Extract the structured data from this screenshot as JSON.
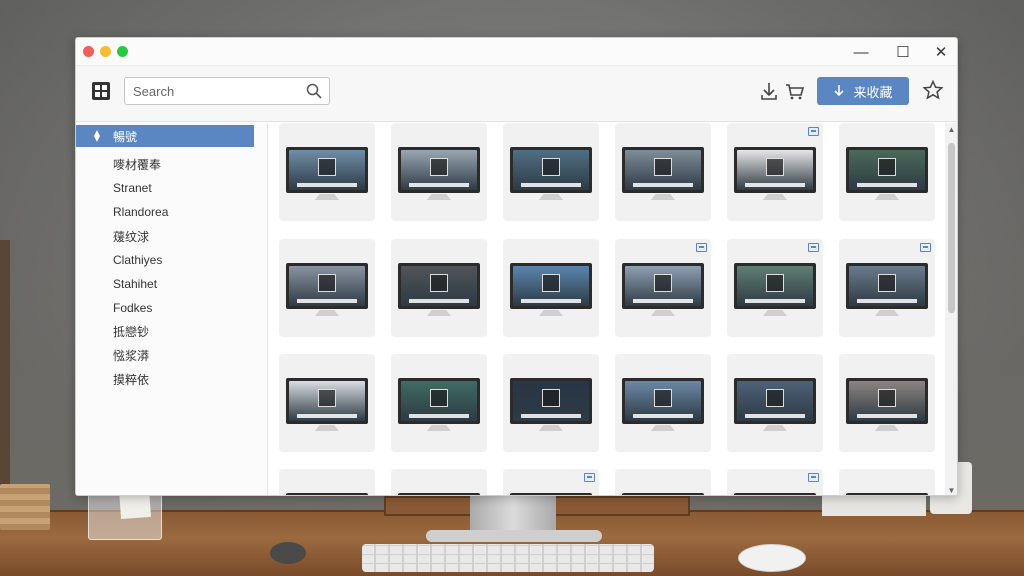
{
  "window": {
    "controls": {
      "minimize": "—",
      "maximize": "☐",
      "close": "✕"
    }
  },
  "toolbar": {
    "search_placeholder": "Search",
    "primary_button_label": "来收藏"
  },
  "sidebar": {
    "items": [
      {
        "label": "暢號",
        "active": true
      },
      {
        "label": "嘜材覆奉",
        "active": false
      },
      {
        "label": "Stranet",
        "active": false
      },
      {
        "label": "Rlandorea",
        "active": false
      },
      {
        "label": "蕿纹浗",
        "active": false
      },
      {
        "label": "Clathiyes",
        "active": false
      },
      {
        "label": "Stahihet",
        "active": false
      },
      {
        "label": "Fodkes",
        "active": false
      },
      {
        "label": "抵戀钞",
        "active": false
      },
      {
        "label": "惤浆漭",
        "active": false
      },
      {
        "label": "摸粹依",
        "active": false
      }
    ]
  },
  "grid": {
    "cards": [
      {
        "theme": "#6f8ea8",
        "badge": false
      },
      {
        "theme": "#9aa7b2",
        "badge": false
      },
      {
        "theme": "#4f6f83",
        "badge": false
      },
      {
        "theme": "#7f8d99",
        "badge": false
      },
      {
        "theme": "#e6e6e6",
        "badge": true
      },
      {
        "theme": "#4a6a5a",
        "badge": false
      },
      {
        "theme": "#8a94a2",
        "badge": false
      },
      {
        "theme": "#505558",
        "badge": false
      },
      {
        "theme": "#5b85ad",
        "badge": false
      },
      {
        "theme": "#8fa0b3",
        "badge": true
      },
      {
        "theme": "#607f74",
        "badge": true
      },
      {
        "theme": "#6a7b8c",
        "badge": true
      },
      {
        "theme": "#d8dde2",
        "badge": false
      },
      {
        "theme": "#3e6c63",
        "badge": false
      },
      {
        "theme": "#283647",
        "badge": false
      },
      {
        "theme": "#6c88a6",
        "badge": false
      },
      {
        "theme": "#4d6278",
        "badge": false
      },
      {
        "theme": "#8b8580",
        "badge": false
      },
      {
        "theme": "#d5d8dc",
        "badge": false
      },
      {
        "theme": "#bfc7ce",
        "badge": false
      },
      {
        "theme": "#d5d8dc",
        "badge": true
      },
      {
        "theme": "#d5d8dc",
        "badge": false
      },
      {
        "theme": "#d5d8dc",
        "badge": true
      },
      {
        "theme": "#56707d",
        "badge": false
      }
    ]
  },
  "colors": {
    "accent": "#5a86c2",
    "window_bg": "#ffffff",
    "card_bg": "#f1f1f1"
  },
  "icons": {
    "grid_view": "grid-view-icon",
    "search": "search-icon",
    "download": "download-icon",
    "cart": "cart-icon",
    "star": "star-icon",
    "badge": "image-badge-icon"
  }
}
